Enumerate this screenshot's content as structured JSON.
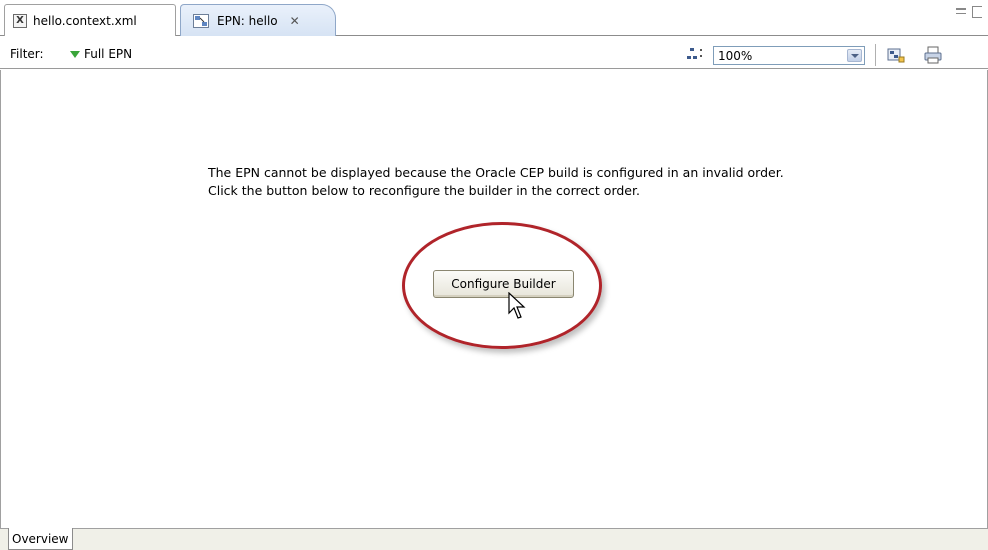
{
  "tabs": [
    {
      "label": "hello.context.xml",
      "icon": "xml-file-icon"
    },
    {
      "label": "EPN: hello",
      "icon": "epn-diagram-icon",
      "active": true
    }
  ],
  "toolbar": {
    "filter_label": "Filter:",
    "filter_value": "Full EPN",
    "zoom_value": "100%"
  },
  "canvas": {
    "message_line1": "The EPN cannot be displayed because the Oracle CEP build is configured in an invalid order.",
    "message_line2": "Click the button below to reconfigure the builder in the correct order.",
    "configure_button_label": "Configure Builder"
  },
  "bottom": {
    "overview_tab": "Overview"
  },
  "colors": {
    "highlight_ring": "#b0242a",
    "filter_triangle": "#3aa53a",
    "active_tab": "#d6e3f4"
  }
}
